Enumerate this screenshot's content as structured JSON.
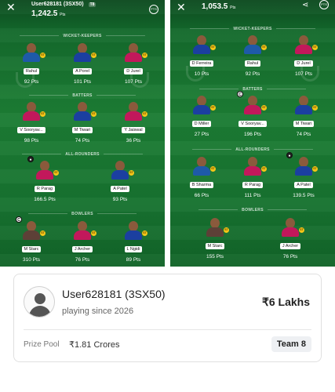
{
  "left_panel": {
    "username": "User628181 (3SX50)",
    "tag": "T8",
    "points": "1,242.5",
    "points_unit": "Pts",
    "pts_icon": "PTS",
    "sections": {
      "wk": "WICKET-KEEPERS",
      "bat": "BATTERS",
      "ar": "ALL-ROUNDERS",
      "bowl": "BOWLERS"
    },
    "players": [
      {
        "name": "Rahul",
        "pts": "92 Pts"
      },
      {
        "name": "A Porel",
        "pts": "101 Pts"
      },
      {
        "name": "D Jurel",
        "pts": "107 Pts"
      },
      {
        "name": "V Sooryav...",
        "pts": "98 Pts"
      },
      {
        "name": "M Tiwari",
        "pts": "74 Pts"
      },
      {
        "name": "Y Jaiswal",
        "pts": "36 Pts"
      },
      {
        "name": "R Parag",
        "pts": "166.5 Pts"
      },
      {
        "name": "A Patel",
        "pts": "93 Pts"
      },
      {
        "name": "M Starc",
        "pts": "310 Pts"
      },
      {
        "name": "J Archer",
        "pts": "76 Pts"
      },
      {
        "name": "L Ngidi",
        "pts": "89 Pts"
      }
    ]
  },
  "right_panel": {
    "points": "1,053.5",
    "points_unit": "Pts",
    "pts_icon": "PTS",
    "share_icon": "share-icon",
    "sections": {
      "wk": "WICKET-KEEPERS",
      "bat": "BATTERS",
      "ar": "ALL-ROUNDERS",
      "bowl": "BOWLERS"
    },
    "players": [
      {
        "name": "D Ferreira",
        "pts": "10 Pts"
      },
      {
        "name": "Rahul",
        "pts": "92 Pts"
      },
      {
        "name": "D Jurel",
        "pts": "107 Pts"
      },
      {
        "name": "D Miller",
        "pts": "27 Pts"
      },
      {
        "name": "V Sooryav...",
        "pts": "196 Pts"
      },
      {
        "name": "M Tiwari",
        "pts": "74 Pts"
      },
      {
        "name": "B Sharma",
        "pts": "66 Pts"
      },
      {
        "name": "R Parag",
        "pts": "111 Pts"
      },
      {
        "name": "A Patel",
        "pts": "139.5 Pts"
      },
      {
        "name": "M Starc",
        "pts": "155 Pts"
      },
      {
        "name": "J Archer",
        "pts": "76 Pts"
      }
    ]
  },
  "card": {
    "username": "User628181 (3SX50)",
    "since": "playing since 2026",
    "prize": "₹6 Lakhs",
    "prize_pool_label": "Prize Pool",
    "prize_pool_value": "₹1.81 Crores",
    "team": "Team 8"
  },
  "colors": {
    "pitch_dark": "#0c4a1f",
    "pitch_mid": "#1c7d34",
    "badge": "#f5c518"
  }
}
